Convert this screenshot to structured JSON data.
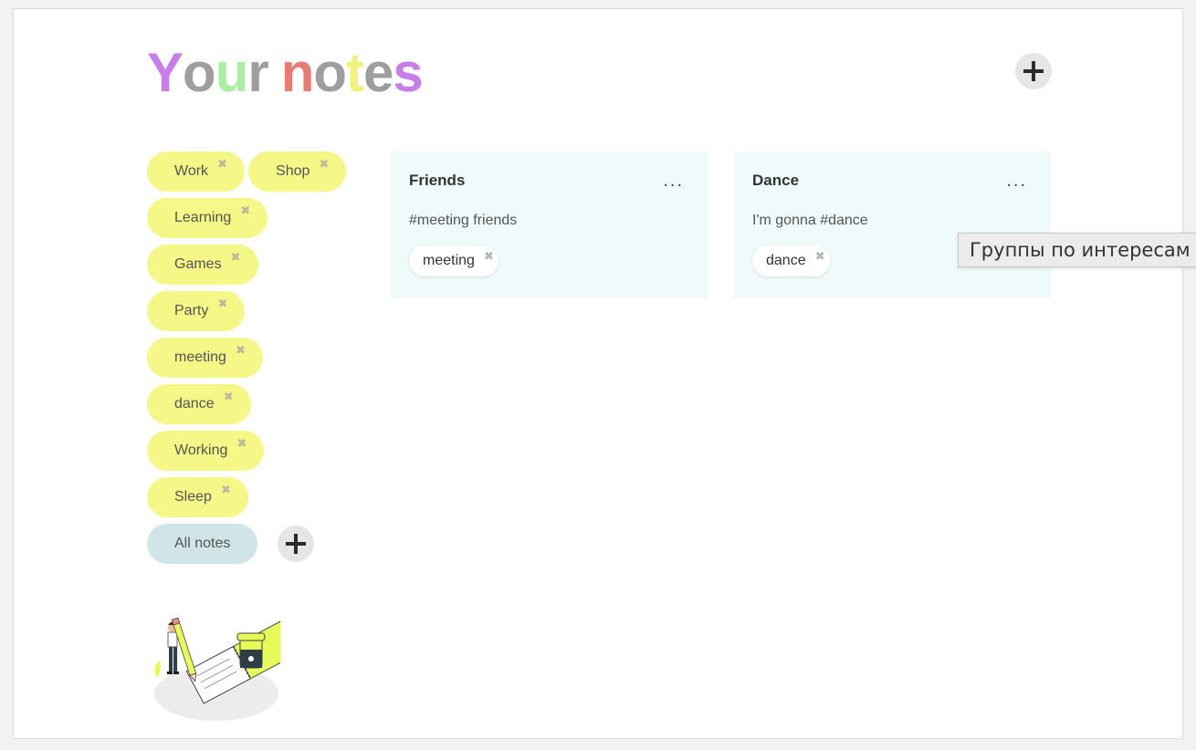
{
  "header": {
    "title_letters": [
      {
        "char": "Y",
        "color": "#c77dea"
      },
      {
        "char": "o",
        "color": "#9e9e9e"
      },
      {
        "char": "u",
        "color": "#a8f0a0"
      },
      {
        "char": "r",
        "color": "#9e9e9e"
      },
      {
        "char": " ",
        "color": "#ffffff"
      },
      {
        "char": "n",
        "color": "#e87a72"
      },
      {
        "char": "o",
        "color": "#9e9e9e"
      },
      {
        "char": "t",
        "color": "#f3f17d"
      },
      {
        "char": "e",
        "color": "#9e9e9e"
      },
      {
        "char": "s",
        "color": "#c77dea"
      }
    ],
    "add_note_icon": "plus-icon"
  },
  "tags": [
    {
      "label": "Work",
      "remove": "✖"
    },
    {
      "label": "Shop",
      "remove": "✖"
    },
    {
      "label": "Learning",
      "remove": "✖"
    },
    {
      "label": "Games",
      "remove": "✖"
    },
    {
      "label": "Party",
      "remove": "✖"
    },
    {
      "label": "meeting",
      "remove": "✖"
    },
    {
      "label": "dance",
      "remove": "✖"
    },
    {
      "label": "Working",
      "remove": "✖"
    },
    {
      "label": "Sleep",
      "remove": "✖"
    }
  ],
  "all_notes_label": "All notes",
  "notes": [
    {
      "title": "Friends",
      "menu": "...",
      "text": "#meeting friends",
      "tag": "meeting",
      "tag_remove": "✖"
    },
    {
      "title": "Dance",
      "menu": "...",
      "text": "I'm gonna #dance",
      "tag": "dance",
      "tag_remove": "✖"
    }
  ],
  "tooltip": "Группы по интересам",
  "colors": {
    "tag_background": "#f5f786",
    "all_notes_background": "#cfe5e7",
    "note_background": "#effbfb",
    "add_button_background": "#e6e6e6"
  }
}
